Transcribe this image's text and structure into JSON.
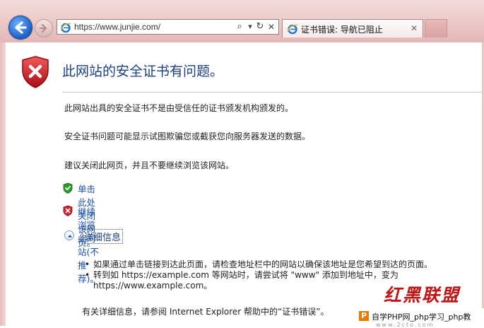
{
  "browser": {
    "url": "https://www.junjie.com/",
    "tab_title": "证书错误: 导航已阻止",
    "buttons": {
      "search": "⌕",
      "dropdown": "▾",
      "refresh": "↻",
      "stop": "✕",
      "tab_close": "✕"
    }
  },
  "page": {
    "title": "此网站的安全证书有问题。",
    "paragraphs": [
      "此网站出具的安全证书不是由受信任的证书颁发机构颁发的。",
      "安全证书问题可能显示试图欺骗您或截获您向服务器发送的数据。",
      "建议关闭此网页，并且不要继续浏览该网站。"
    ],
    "close_link": "单击此处关闭该网页。",
    "continue_link": "继续浏览此网站(不推荐)。",
    "details_label": "详细信息",
    "details_items": [
      "如果通过单击链接到达此页面，请检查地址栏中的网站以确保该地址是您希望到达的页面。",
      "转到如 https://example.com 等网站时，请尝试将 \"www\" 添加到地址中，变为 https://www.example.com。"
    ],
    "more_info": "有关详细信息，请参阅 Internet Explorer 帮助中的“证书错误”。"
  },
  "watermark": {
    "title": "红黑联盟",
    "logo": "P",
    "text": "自学PHP网_php学习_php教",
    "url": "www.2cto.com"
  },
  "colors": {
    "accent": "#1a3e86",
    "link": "#1a4fae",
    "error_red": "#c8131e",
    "ok_green": "#2f9a2c"
  }
}
